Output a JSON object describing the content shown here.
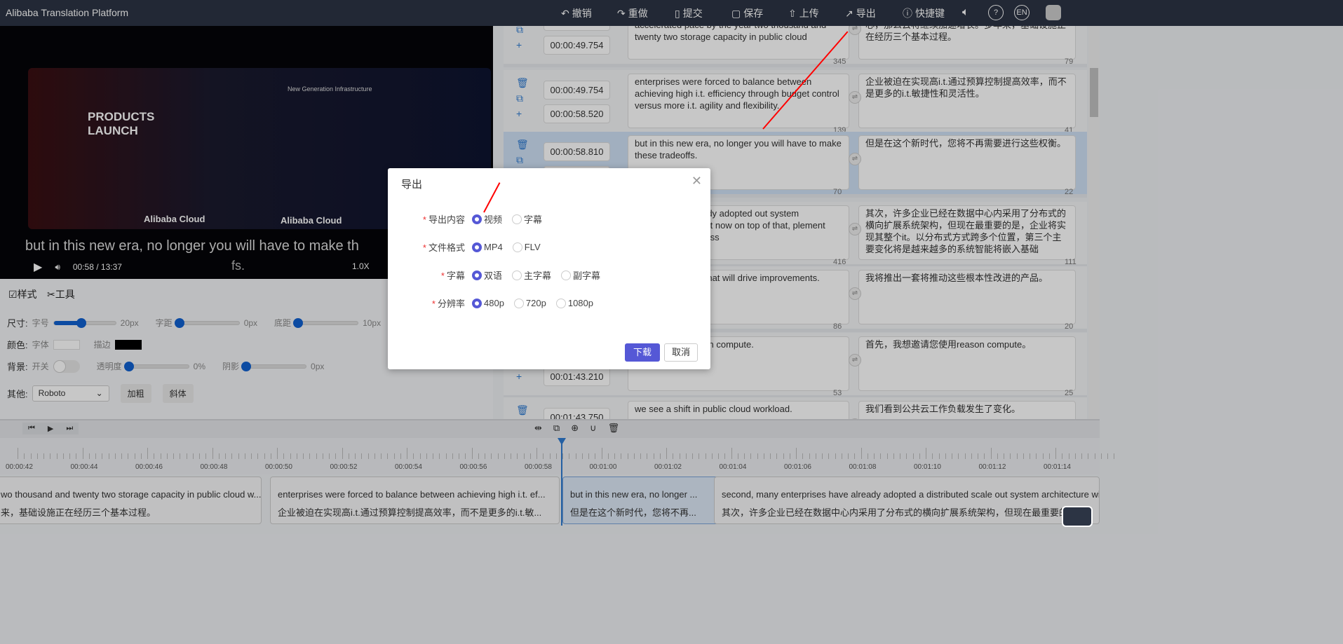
{
  "app_title": "Alibaba Translation Platform",
  "toolbar": {
    "undo": "撤销",
    "redo": "重做",
    "submit": "提交",
    "save": "保存",
    "upload": "上传",
    "export": "导出",
    "shortcuts": "快捷键",
    "lang": "EN"
  },
  "video": {
    "stage_title": "PRODUCTS LAUNCH",
    "stage_sub": "New Generation Infrastructure",
    "logo": "Alibaba Cloud",
    "subtitle": "but in this new era, no longer you will have to make th",
    "subtitle2": "fs.",
    "time": "00:58 / 13:37",
    "speed": "1.0X"
  },
  "panel": {
    "tab_style": "样式",
    "tab_tools": "工具",
    "size_label": "尺寸:",
    "font_size": "字号",
    "font_size_val": "20px",
    "font_size_pct": 45,
    "spacing": "字距",
    "spacing_val": "0px",
    "bottom": "底距",
    "bottom_val": "10px",
    "color_label": "颜色:",
    "font_color": "字体",
    "stroke": "描边",
    "bg_label": "背景:",
    "toggle": "开关",
    "opacity": "透明度",
    "opacity_val": "0%",
    "shadow": "阴影",
    "shadow_val": "0px",
    "other_label": "其他:",
    "font": "Roboto",
    "bold": "加粗",
    "italic": "斜体"
  },
  "rows": [
    {
      "start": "",
      "end": "00:00:49.754",
      "en": "traditional i.t. and a cloud will continue to grow an accelerated pace by the year two thousand and twenty two storage capacity in public cloud",
      "zh": "代，公共云的存储容量将超过传统的企业数据中心，那么云将继续加速增长。多年来，基础设施正在经历三个基本过程。",
      "en_count": "345",
      "zh_count": "79"
    },
    {
      "start": "00:00:49.754",
      "end": "00:00:58.520",
      "en": "enterprises were forced to balance between achieving high i.t. efficiency through budget control versus more i.t. agility and flexibility.",
      "zh": "企业被迫在实现高i.t.通过预算控制提高效率，而不是更多的i.t.敏捷性和灵活性。",
      "en_count": "139",
      "zh_count": "41"
    },
    {
      "start": "00:00:58.810",
      "end": "",
      "en": "but in this new era, no longer you will have to make these tradeoffs.",
      "zh": "但是在这个新时代，您将不再需要进行这些权衡。",
      "en_count": "70",
      "zh_count": "22"
    },
    {
      "start": "",
      "end": "",
      "en": "rprises have already adopted out system architecture ter, but now on top of that, plement their entire i.t. across",
      "zh": "其次，许多企业已经在数据中心内采用了分布式的横向扩展系统架构，但现在最重要的是，企业将实现其整个it。以分布式方式跨多个位置，第三个主要变化将是越来越多的系统智能将嵌入基础",
      "en_count": "416",
      "zh_count": "111"
    },
    {
      "start": "",
      "end": "",
      "en": "a set of products that will drive improvements.",
      "zh": "我将推出一套将推动这些根本性改进的产品。",
      "en_count": "86",
      "zh_count": "20"
    },
    {
      "start": "",
      "end": "00:01:43.210",
      "en": "invite you to reason compute.",
      "zh": "首先，我想邀请您使用reason compute。",
      "en_count": "53",
      "zh_count": "25"
    },
    {
      "start": "00:01:43.750",
      "end": "",
      "en": "we see a shift in public cloud workload.",
      "zh": "我们看到公共云工作负载发生了变化。",
      "en_count": "",
      "zh_count": ""
    }
  ],
  "timeline": {
    "ticks": [
      "00:00:42",
      "00:00:44",
      "00:00:46",
      "00:00:48",
      "00:00:50",
      "00:00:52",
      "00:00:54",
      "00:00:56",
      "00:00:58",
      "00:01:00",
      "00:01:02",
      "00:01:04",
      "00:01:06",
      "00:01:08",
      "00:01:10",
      "00:01:12",
      "00:01:14"
    ],
    "clips": [
      {
        "en": "wo thousand and twenty two storage capacity in public cloud w...",
        "zh": "来，基础设施正在经历三个基本过程。"
      },
      {
        "en": "enterprises were forced to balance between achieving high i.t. ef...",
        "zh": "企业被迫在实现高i.t.通过预算控制提高效率，而不是更多的i.t.敏..."
      },
      {
        "en": "but in this new era, no longer ...",
        "zh": "但是在这个新时代，您将不再..."
      },
      {
        "en": "second, many enterprises have already adopted a distributed scale out system architecture wi",
        "zh": "其次，许多企业已经在数据中心内采用了分布式的横向扩展系统架构，但现在最重要的"
      }
    ]
  },
  "modal": {
    "title": "导出",
    "fields": [
      {
        "label": "导出内容",
        "options": [
          "视频",
          "字幕"
        ],
        "selected": 0
      },
      {
        "label": "文件格式",
        "options": [
          "MP4",
          "FLV"
        ],
        "selected": 0
      },
      {
        "label": "字幕",
        "options": [
          "双语",
          "主字幕",
          "副字幕"
        ],
        "selected": 0
      },
      {
        "label": "分辨率",
        "options": [
          "480p",
          "720p",
          "1080p"
        ],
        "selected": 0
      }
    ],
    "download": "下载",
    "cancel": "取消"
  },
  "colors": {
    "accent": "#5558d6",
    "topbar": "#2c3444",
    "slider": "#1060d0",
    "active_row": "#cfe0f5",
    "annotation": "#ff0000"
  }
}
